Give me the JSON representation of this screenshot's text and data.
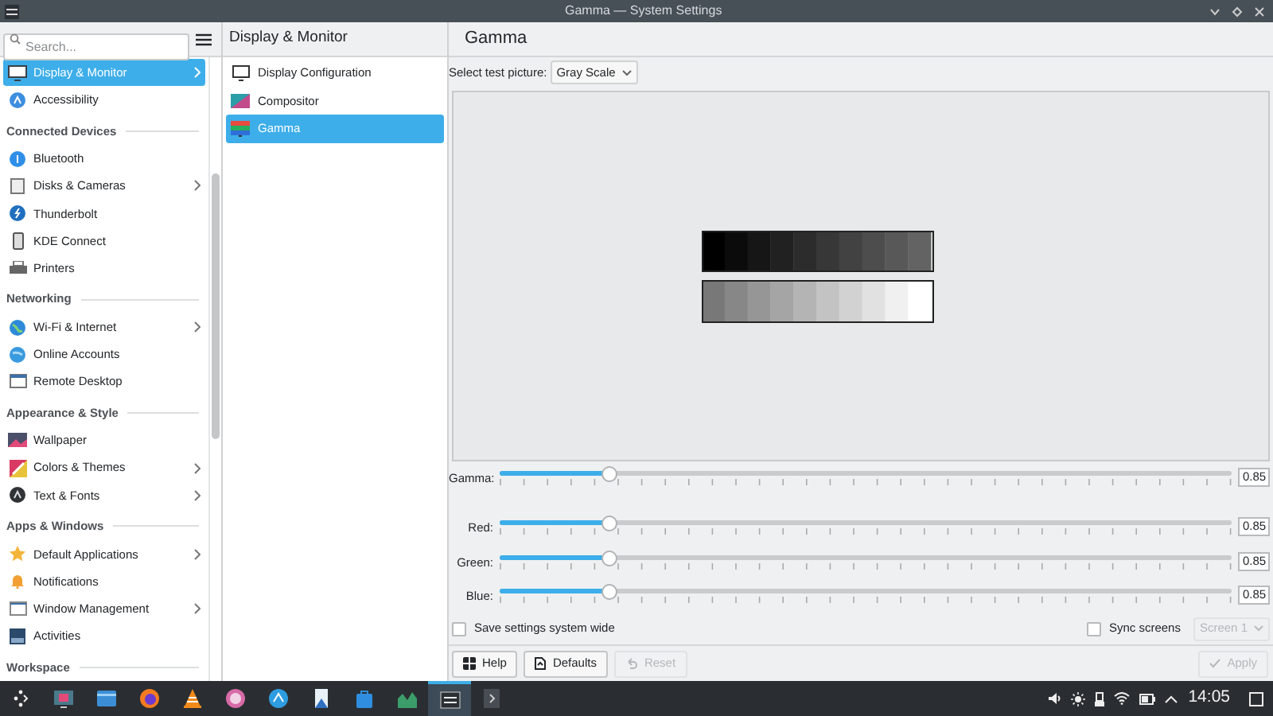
{
  "window": {
    "title": "Gamma — System Settings"
  },
  "sidebar": {
    "search": {
      "placeholder": "Search..."
    },
    "sections": [
      {
        "items": [
          {
            "label": "Display & Monitor",
            "selected": true,
            "expandable": true
          },
          {
            "label": "Accessibility",
            "selected": false,
            "expandable": false
          }
        ]
      },
      {
        "header": "Connected Devices",
        "items": [
          {
            "label": "Bluetooth",
            "selected": false,
            "expandable": false
          },
          {
            "label": "Disks & Cameras",
            "selected": false,
            "expandable": true
          },
          {
            "label": "Thunderbolt",
            "selected": false,
            "expandable": false
          },
          {
            "label": "KDE Connect",
            "selected": false,
            "expandable": false
          },
          {
            "label": "Printers",
            "selected": false,
            "expandable": false
          }
        ]
      },
      {
        "header": "Networking",
        "items": [
          {
            "label": "Wi-Fi & Internet",
            "selected": false,
            "expandable": true
          },
          {
            "label": "Online Accounts",
            "selected": false,
            "expandable": false
          },
          {
            "label": "Remote Desktop",
            "selected": false,
            "expandable": false
          }
        ]
      },
      {
        "header": "Appearance & Style",
        "items": [
          {
            "label": "Wallpaper",
            "selected": false,
            "expandable": false
          },
          {
            "label": "Colors & Themes",
            "selected": false,
            "expandable": true
          },
          {
            "label": "Text & Fonts",
            "selected": false,
            "expandable": true
          }
        ]
      },
      {
        "header": "Apps & Windows",
        "items": [
          {
            "label": "Default Applications",
            "selected": false,
            "expandable": true
          },
          {
            "label": "Notifications",
            "selected": false,
            "expandable": false
          },
          {
            "label": "Window Management",
            "selected": false,
            "expandable": true
          },
          {
            "label": "Activities",
            "selected": false,
            "expandable": false
          }
        ]
      },
      {
        "header": "Workspace"
      }
    ]
  },
  "subpanel": {
    "title": "Display & Monitor",
    "items": [
      {
        "label": "Display Configuration",
        "selected": false
      },
      {
        "label": "Compositor",
        "selected": false
      },
      {
        "label": "Gamma",
        "selected": true
      }
    ]
  },
  "content": {
    "title": "Gamma",
    "test_picture": {
      "label": "Select test picture:",
      "value": "Gray Scale"
    },
    "sliders": [
      {
        "label": "Gamma:",
        "level": 0.15,
        "value": "0.85"
      },
      {
        "label": "Red:",
        "level": 0.15,
        "value": "0.85"
      },
      {
        "label": "Green:",
        "level": 0.15,
        "value": "0.85"
      },
      {
        "label": "Blue:",
        "level": 0.15,
        "value": "0.85"
      }
    ],
    "save_system_wide": {
      "label": "Save settings system wide",
      "checked": false
    },
    "sync_screens": {
      "label": "Sync screens",
      "checked": false
    },
    "screen_select": {
      "value": "Screen 1",
      "disabled": true
    },
    "buttons": [
      {
        "label": "Help",
        "disabled": false
      },
      {
        "label": "Defaults",
        "disabled": false
      },
      {
        "label": "Reset",
        "disabled": true
      }
    ],
    "apply_button": {
      "label": "Apply",
      "disabled": true
    }
  },
  "taskbar": {
    "apps": [
      {
        "selected": false
      },
      {
        "selected": false
      },
      {
        "selected": false
      },
      {
        "selected": false
      },
      {
        "selected": false
      },
      {
        "selected": false
      },
      {
        "selected": false
      },
      {
        "selected": false
      },
      {
        "selected": false
      },
      {
        "selected": true
      }
    ],
    "clock": "14:05"
  }
}
